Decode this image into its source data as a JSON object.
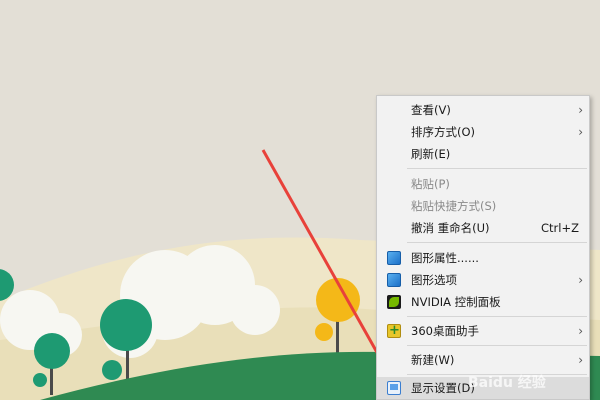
{
  "context_menu": {
    "items": [
      {
        "label": "查看(V)",
        "submenu": true,
        "disabled": false
      },
      {
        "label": "排序方式(O)",
        "submenu": true,
        "disabled": false
      },
      {
        "label": "刷新(E)",
        "submenu": false,
        "disabled": false
      },
      {
        "label": "粘贴(P)",
        "submenu": false,
        "disabled": true
      },
      {
        "label": "粘贴快捷方式(S)",
        "submenu": false,
        "disabled": true
      },
      {
        "label": "撤消 重命名(U)",
        "shortcut": "Ctrl+Z",
        "disabled": false
      },
      {
        "label": "图形属性......",
        "icon": "intel-graphics-icon",
        "disabled": false
      },
      {
        "label": "图形选项",
        "icon": "intel-graphics-icon",
        "submenu": true,
        "disabled": false
      },
      {
        "label": "NVIDIA 控制面板",
        "icon": "nvidia-icon",
        "disabled": false
      },
      {
        "label": "360桌面助手",
        "icon": "360-icon",
        "submenu": true,
        "disabled": false
      },
      {
        "label": "新建(W)",
        "submenu": true,
        "disabled": false
      },
      {
        "label": "显示设置(D)",
        "icon": "display-settings-icon",
        "disabled": false
      }
    ]
  },
  "watermark": "Baidu 经验",
  "colors": {
    "menu_bg": "#f2f2f2",
    "annotation_arrow": "#e8413a",
    "wallpaper_sky": "#e3dfd6",
    "hill_green": "#2f8a52"
  }
}
